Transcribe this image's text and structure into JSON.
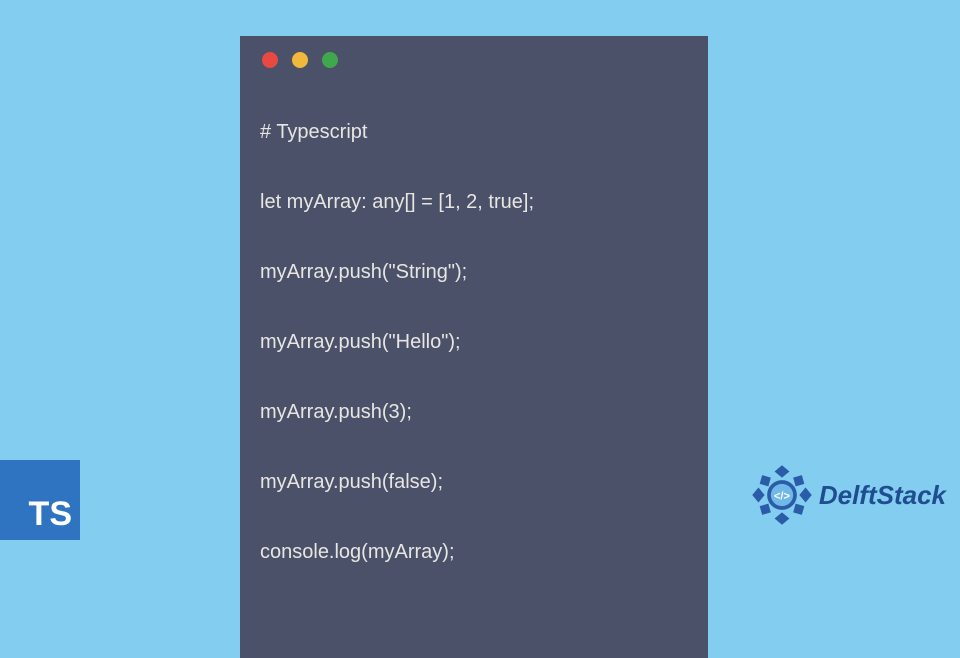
{
  "code": {
    "lines": [
      "# Typescript",
      "let myArray: any[] = [1, 2, true];",
      "myArray.push(\"String\");",
      "myArray.push(\"Hello\");",
      "myArray.push(3);",
      "myArray.push(false);",
      "console.log(myArray);"
    ]
  },
  "badges": {
    "typescript": "TS",
    "brand": "DelftStack"
  },
  "colors": {
    "page_bg": "#82cdf0",
    "window_bg": "#4a5168",
    "code_text": "#e8e6e3",
    "ts_bg": "#2f74c0",
    "brand_text": "#1f4d90",
    "dot_red": "#e84a43",
    "dot_yellow": "#f0b93b",
    "dot_green": "#3fa84c"
  }
}
